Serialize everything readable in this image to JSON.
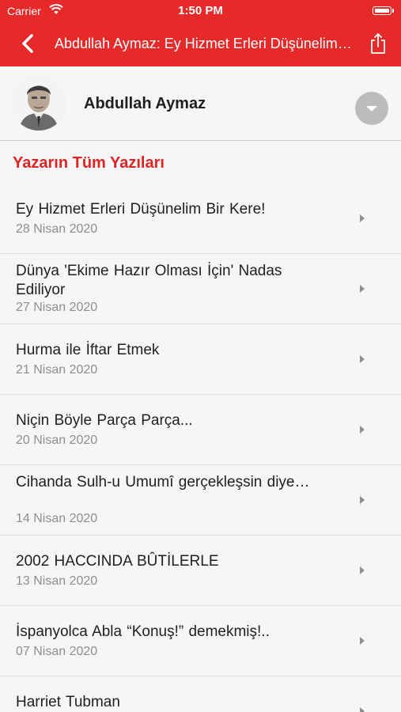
{
  "status_bar": {
    "carrier": "Carrier",
    "time": "1:50 PM"
  },
  "nav": {
    "title": "Abdullah Aymaz: Ey Hizmet Erleri Düşünelim Bir Kere!"
  },
  "author": {
    "name": "Abdullah Aymaz"
  },
  "section": {
    "title": "Yazarın Tüm Yazıları"
  },
  "articles": [
    {
      "title": "Ey Hizmet Erleri Düşünelim Bir Kere!",
      "date": "28 Nisan 2020"
    },
    {
      "title": "Dünya 'Ekime Hazır Olması İçin' Nadas Ediliyor",
      "date": "27 Nisan 2020"
    },
    {
      "title": "Hurma ile İftar Etmek",
      "date": "21 Nisan 2020"
    },
    {
      "title": "Niçin Böyle Parça Parça...",
      "date": "20 Nisan 2020"
    },
    {
      "title": "Cihanda  Sulh-u  Umumî  gerçekleşsin diye…",
      "date": "14 Nisan 2020"
    },
    {
      "title": "2002  HACCINDA  BÛTİLERLE",
      "date": "13 Nisan 2020"
    },
    {
      "title": "İspanyolca  Abla  “Konuş!”  demekmiş!..",
      "date": "07 Nisan 2020"
    },
    {
      "title": "Harriet Tubman",
      "date": ""
    }
  ],
  "colors": {
    "accent": "#e62a2a",
    "section_title": "#df2424"
  },
  "icons": {
    "back": "chevron-left-icon",
    "share": "share-icon",
    "expand": "chevron-down-icon",
    "row": "chevron-right-icon"
  }
}
